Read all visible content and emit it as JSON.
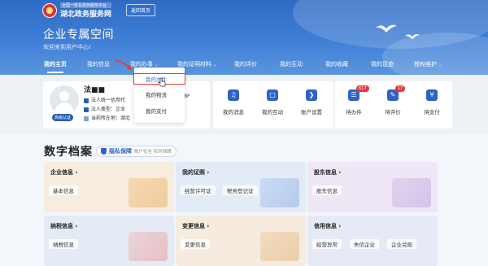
{
  "header": {
    "logo_subtitle": "全国一体化政务服务平台",
    "logo_title": "湖北政务服务网",
    "back_home": "返回首页",
    "space_title": "企业专属空间",
    "welcome": "欢迎来到用户中心!"
  },
  "nav": {
    "items": [
      {
        "label": "我的主页"
      },
      {
        "label": "我的信息"
      },
      {
        "label": "我的办事"
      },
      {
        "label": "我的证明材料"
      },
      {
        "label": "我的评价"
      },
      {
        "label": "我的互动"
      },
      {
        "label": "我的收藏"
      },
      {
        "label": "我的足迹"
      },
      {
        "label": "授权维护"
      }
    ]
  },
  "dropdown": {
    "items": [
      {
        "label": "我的办件"
      },
      {
        "label": "我的物流"
      },
      {
        "label": "我的支付"
      }
    ]
  },
  "profile": {
    "name": "法■■",
    "line1_label": "法人统一信用代",
    "line1_tail": "L8F",
    "line2_label": "法人类型：企业",
    "line3_label": "当前所在地：湖北",
    "verify_badge": "高级认证"
  },
  "quick_links": [
    {
      "label": "我的消息",
      "icon": "bell-icon"
    },
    {
      "label": "我的互动",
      "icon": "chat-icon"
    },
    {
      "label": "账户设置",
      "icon": "settings-icon"
    },
    {
      "label": "待办件",
      "icon": "todo-icon",
      "badge": "617"
    },
    {
      "label": "待评价",
      "icon": "rate-icon",
      "badge": "17"
    },
    {
      "label": "待支付",
      "icon": "pay-icon"
    }
  ],
  "archive": {
    "title": "数字档案",
    "privacy_title": "隐私保障",
    "privacy_sub": "账户安全 实时保障",
    "cards": [
      {
        "title": "企业信息",
        "tags": [
          "基本信息"
        ],
        "color": "#f6eddf"
      },
      {
        "title": "我的证照",
        "tags": [
          "经营许可证",
          "税务登记证"
        ],
        "color": "#e3ebf7"
      },
      {
        "title": "股东信息",
        "tags": [
          "股东信息"
        ],
        "color": "#efe7f5"
      },
      {
        "title": "纳税信息",
        "tags": [
          "纳税信息"
        ],
        "color": "#e4ebf5"
      },
      {
        "title": "变更信息",
        "tags": [
          "变更信息"
        ],
        "color": "#f5ecdf"
      },
      {
        "title": "信用信息",
        "tags": [
          "经营异常",
          "失信企业",
          "企业兑现"
        ],
        "color": "#e6eaf6"
      }
    ]
  },
  "colors": {
    "brand_blue": "#2f6bc4",
    "highlight_red": "#e53935"
  }
}
